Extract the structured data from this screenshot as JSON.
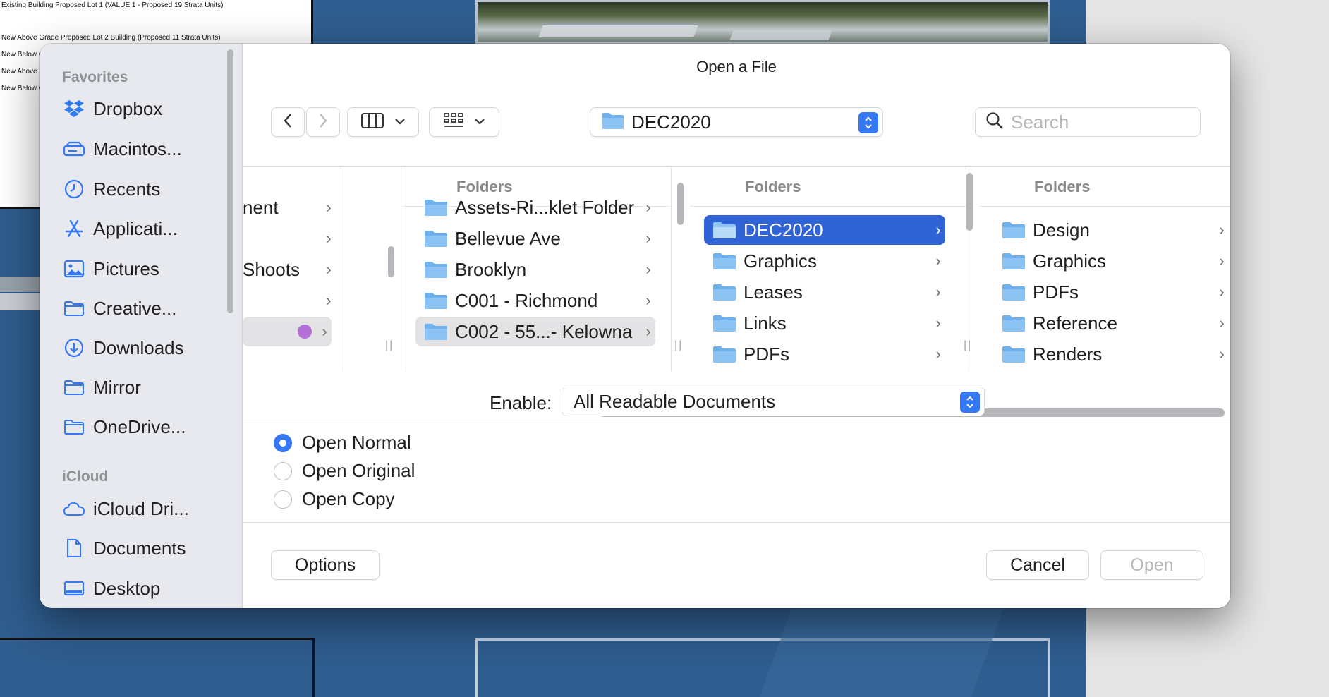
{
  "background": {
    "doc_lines": [
      "Existing Building Proposed Lot 1 (VALUE 1 - Proposed 19 Strata Units)",
      "New Above Grade Proposed Lot 2 Building (Proposed 11 Strata Units)",
      "New Below G",
      "New Above G",
      "New Below G"
    ]
  },
  "dialog": {
    "title": "Open a File",
    "path_popup": "DEC2020",
    "search_placeholder": "Search"
  },
  "sidebar": {
    "favorites_heading": "Favorites",
    "favorites": [
      {
        "label": "Dropbox",
        "icon": "dropbox-icon"
      },
      {
        "label": "Macintos...",
        "icon": "hard-drive-icon"
      },
      {
        "label": "Recents",
        "icon": "clock-icon"
      },
      {
        "label": "Applicati...",
        "icon": "applications-icon"
      },
      {
        "label": "Pictures",
        "icon": "pictures-icon"
      },
      {
        "label": "Creative...",
        "icon": "folder-icon"
      },
      {
        "label": "Downloads",
        "icon": "downloads-icon"
      },
      {
        "label": "Mirror",
        "icon": "folder-icon"
      },
      {
        "label": "OneDrive...",
        "icon": "folder-icon"
      }
    ],
    "icloud_heading": "iCloud",
    "icloud": [
      {
        "label": "iCloud Dri...",
        "icon": "cloud-icon"
      },
      {
        "label": "Documents",
        "icon": "document-icon"
      },
      {
        "label": "Desktop",
        "icon": "desktop-icon"
      }
    ]
  },
  "browser": {
    "col0": {
      "rows": [
        "nent",
        "",
        "Shoots",
        "",
        ""
      ]
    },
    "col1": {
      "header": "Folders",
      "rows": [
        "Assets-Ri...klet Folder",
        "Bellevue Ave",
        "Brooklyn",
        "C001 - Richmond",
        "C002 - 55...- Kelowna"
      ]
    },
    "col2": {
      "header": "Folders",
      "rows": [
        "DEC2020",
        "Graphics",
        "Leases",
        "Links",
        "PDFs"
      ]
    },
    "col3": {
      "header": "Folders",
      "rows": [
        "Design",
        "Graphics",
        "PDFs",
        "Reference",
        "Renders"
      ]
    }
  },
  "enable": {
    "label": "Enable:",
    "value": "All Readable Documents"
  },
  "open_mode": {
    "options": [
      "Open Normal",
      "Open Original",
      "Open Copy"
    ],
    "selected": "Open Normal"
  },
  "buttons": {
    "options": "Options",
    "cancel": "Cancel",
    "open": "Open"
  },
  "colors": {
    "accent": "#3478f6",
    "selection": "#2f63d6",
    "folder": "#6fb1ec",
    "tag_purple": "#b46fd6"
  }
}
